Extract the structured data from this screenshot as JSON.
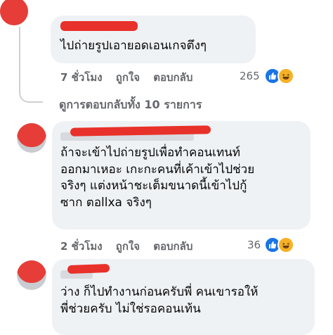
{
  "comments": [
    {
      "text": "ไปถ่ายรูปเอายอดเอนเกจตึงๆ",
      "time": "7 ชั่วโมง",
      "like_label": "ถูกใจ",
      "reply_label": "ตอบกลับ",
      "reaction_count": "265"
    },
    {
      "text": "ถ้าจะเข้าไปถ่ายรูปเพื่อทำคอนเทนท์\nออกมาเหอะ เกะกะคนที่เค้าเข้าไปช่วย\nจริงๆ แต่งหน้าชะเต็มขนาดนี้เข้าไปกู้\nซาก ตอllxa จริงๆ",
      "time": "2 ชั่วโมง",
      "like_label": "ถูกใจ",
      "reply_label": "ตอบกลับ",
      "reaction_count": "36"
    },
    {
      "text": "ว่าง ก็ไปทำงานก่อนครับพี่ คนเขารอให้\nพี่ช่วยครับ ไม่ใช่รอคอนเท้น"
    }
  ],
  "view_replies": "ดูการตอบกลับทั้ง 10 รายการ",
  "reactions": [
    "like-icon",
    "haha-icon"
  ],
  "colors": {
    "redaction": "#e8312a",
    "bubble": "#eff2f5",
    "meta": "#65676b",
    "like": "#1b74e4",
    "haha": "#f7b125"
  }
}
